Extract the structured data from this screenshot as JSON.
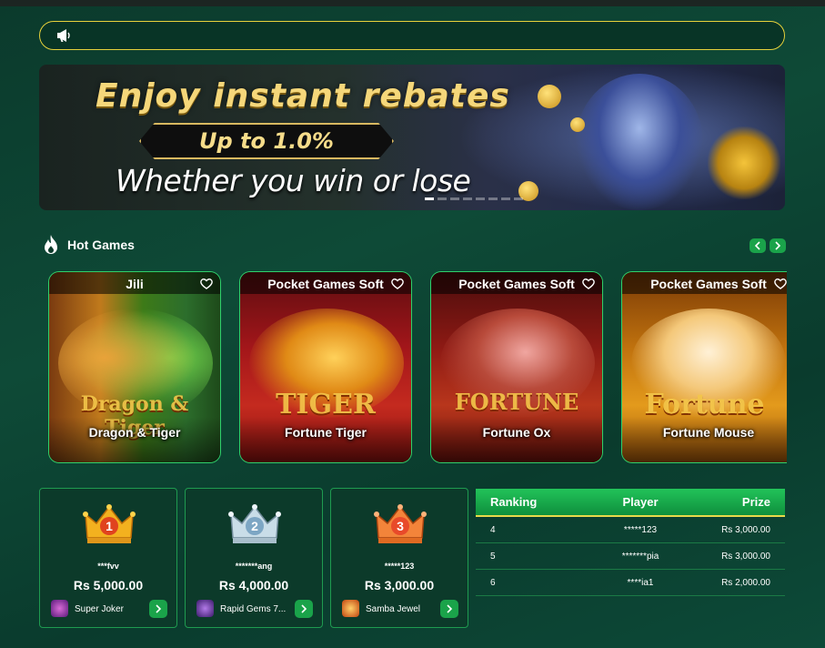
{
  "marquee": {
    "text": ""
  },
  "banner": {
    "title": "Enjoy instant rebates",
    "pill": "Up to 1.0%",
    "subtitle": "Whether you win or lose",
    "slides": 8,
    "active_slide": 0
  },
  "hot_games": {
    "title": "Hot Games",
    "cards": [
      {
        "provider": "Jili",
        "name": "Dragon & Tiger",
        "logo": "Dragon & Tiger"
      },
      {
        "provider": "Pocket Games Soft",
        "name": "Fortune Tiger",
        "logo": "TIGER"
      },
      {
        "provider": "Pocket Games Soft",
        "name": "Fortune Ox",
        "logo": "FORTUNE"
      },
      {
        "provider": "Pocket Games Soft",
        "name": "Fortune Mouse",
        "logo": "Fortune"
      }
    ]
  },
  "winners": [
    {
      "rank_icon": "gold-crown-1-icon",
      "user": "***fvv",
      "amount": "Rs 5,000.00",
      "game": "Super Joker"
    },
    {
      "rank_icon": "silver-crown-2-icon",
      "user": "*******ang",
      "amount": "Rs 4,000.00",
      "game": "Rapid Gems 7..."
    },
    {
      "rank_icon": "bronze-crown-3-icon",
      "user": "*****123",
      "amount": "Rs 3,000.00",
      "game": "Samba Jewel"
    }
  ],
  "ranking": {
    "headers": {
      "ranking": "Ranking",
      "player": "Player",
      "prize": "Prize"
    },
    "rows": [
      {
        "rank": "4",
        "player": "*****123",
        "prize": "Rs 3,000.00"
      },
      {
        "rank": "5",
        "player": "*******pia",
        "prize": "Rs 3,000.00"
      },
      {
        "rank": "6",
        "player": "****ia1",
        "prize": "Rs 2,000.00"
      }
    ]
  },
  "colors": {
    "accent": "#1aa34a",
    "border": "#2fd06b",
    "highlight": "#e6d13b"
  }
}
